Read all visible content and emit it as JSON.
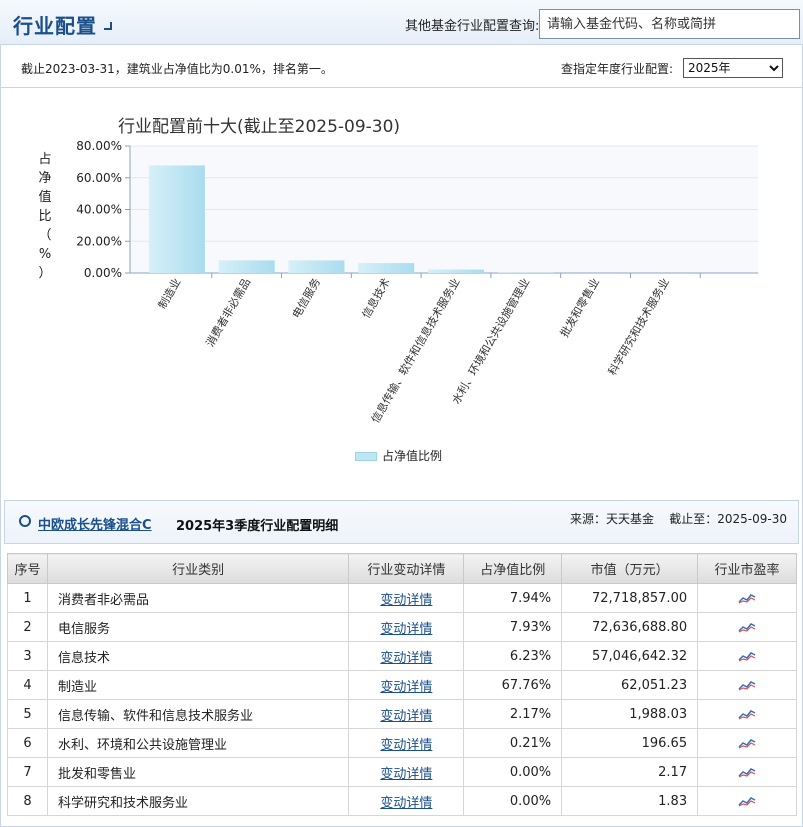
{
  "header": {
    "title": "行业配置",
    "search_label": "其他基金行业配置查询:",
    "search_placeholder": "请输入基金代码、名称或简拼"
  },
  "info": {
    "note": "截止2023-03-31，建筑业占净值比为0.01%，排名第一。",
    "year_label": "查指定年度行业配置:",
    "year_selected": "2025年"
  },
  "chart_data": {
    "type": "bar",
    "title": "行业配置前十大(截止至2025-09-30)",
    "ylabel": "占净值比（%）",
    "ylim": [
      0,
      80
    ],
    "yticks": [
      "80.00%",
      "60.00%",
      "40.00%",
      "20.00%",
      "0.00%"
    ],
    "categories": [
      "制造业",
      "消费者非必需品",
      "电信服务",
      "信息技术",
      "信息传输、软件和信息技术服务业",
      "水利、环境和公共设施管理业",
      "批发和零售业",
      "科学研究和技术服务业"
    ],
    "series": [
      {
        "name": "占净值比例",
        "values": [
          67.76,
          7.94,
          7.93,
          6.23,
          2.17,
          0.21,
          0.0,
          0.0
        ]
      }
    ],
    "bar_color": "#bfe6f3",
    "grid": true,
    "legend_position": "bottom"
  },
  "detail": {
    "fund_name": "中欧成长先锋混合C",
    "subtitle": "2025年3季度行业配置明细",
    "source": "来源：天天基金    截止至：2025-09-30",
    "columns": [
      "序号",
      "行业类别",
      "行业变动详情",
      "占净值比例",
      "市值（万元）",
      "行业市盈率"
    ],
    "link_label": "变动详情",
    "rows": [
      {
        "no": "1",
        "industry": "消费者非必需品",
        "ratio": "7.94%",
        "value": "72,718,857.00"
      },
      {
        "no": "2",
        "industry": "电信服务",
        "ratio": "7.93%",
        "value": "72,636,688.80"
      },
      {
        "no": "3",
        "industry": "信息技术",
        "ratio": "6.23%",
        "value": "57,046,642.32"
      },
      {
        "no": "4",
        "industry": "制造业",
        "ratio": "67.76%",
        "value": "62,051.23"
      },
      {
        "no": "5",
        "industry": "信息传输、软件和信息技术服务业",
        "ratio": "2.17%",
        "value": "1,988.03"
      },
      {
        "no": "6",
        "industry": "水利、环境和公共设施管理业",
        "ratio": "0.21%",
        "value": "196.65"
      },
      {
        "no": "7",
        "industry": "批发和零售业",
        "ratio": "0.00%",
        "value": "2.17"
      },
      {
        "no": "8",
        "industry": "科学研究和技术服务业",
        "ratio": "0.00%",
        "value": "1.83"
      }
    ]
  }
}
